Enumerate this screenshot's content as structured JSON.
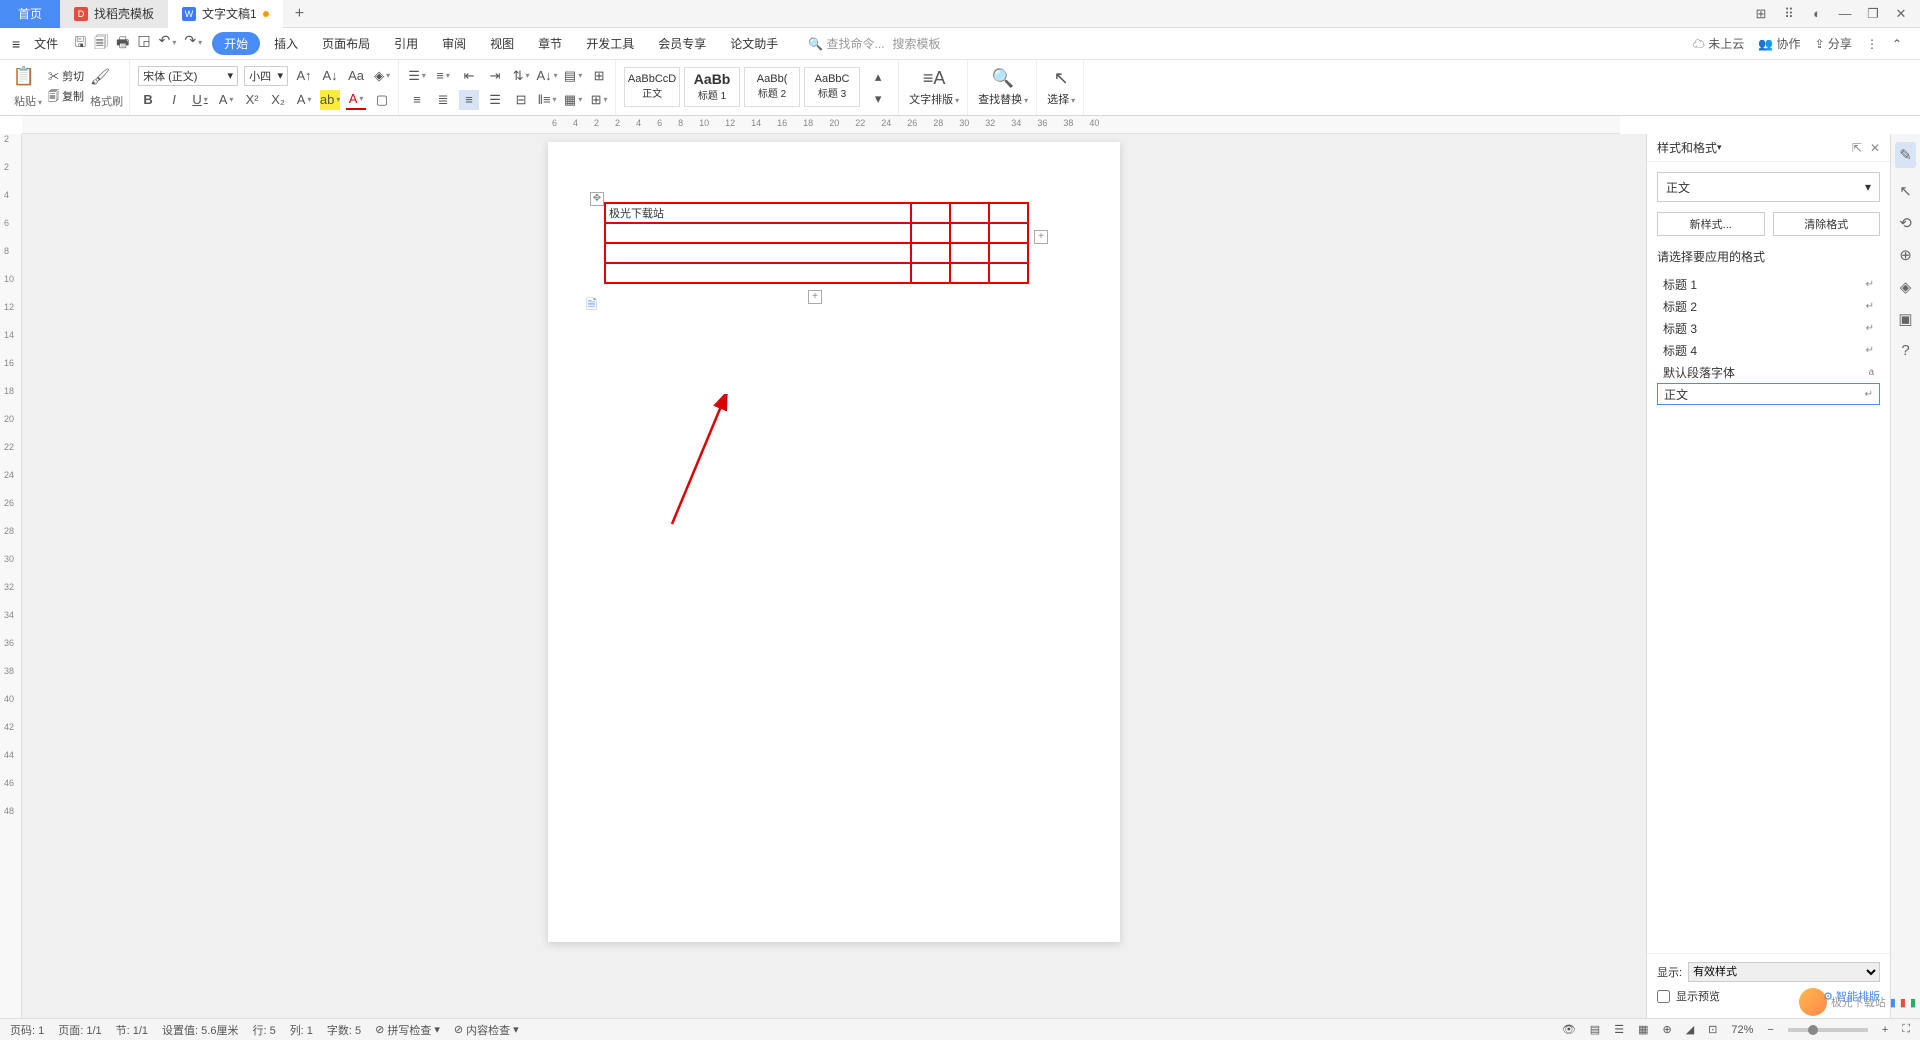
{
  "tabs": {
    "home": "首页",
    "template": "找稻壳模板",
    "doc": "文字文稿1"
  },
  "menu": {
    "file": "文件",
    "items": [
      "开始",
      "插入",
      "页面布局",
      "引用",
      "审阅",
      "视图",
      "章节",
      "开发工具",
      "会员专享",
      "论文助手"
    ],
    "search_cmd": "查找命令...",
    "search_tpl": "搜索模板"
  },
  "top_right": {
    "cloud": "未上云",
    "collab": "协作",
    "share": "分享"
  },
  "ribbon": {
    "paste": "粘贴",
    "cut": "剪切",
    "copy": "复制",
    "format_painter": "格式刷",
    "font_name": "宋体 (正文)",
    "font_size": "小四",
    "styles": [
      {
        "preview": "AaBbCcD",
        "label": "正文"
      },
      {
        "preview": "AaBb",
        "label": "标题 1"
      },
      {
        "preview": "AaBb(",
        "label": "标题 2"
      },
      {
        "preview": "AaBbC",
        "label": "标题 3"
      }
    ],
    "text_layout": "文字排版",
    "find_replace": "查找替换",
    "select": "选择"
  },
  "ruler_h": [
    "6",
    "4",
    "2",
    "2",
    "4",
    "6",
    "8",
    "10",
    "12",
    "14",
    "16",
    "18",
    "20",
    "22",
    "24",
    "26",
    "28",
    "30",
    "32",
    "34",
    "36",
    "38",
    "40"
  ],
  "ruler_v": [
    "2",
    "2",
    "4",
    "6",
    "8",
    "10",
    "12",
    "14",
    "16",
    "18",
    "20",
    "22",
    "24",
    "26",
    "28",
    "30",
    "32",
    "34",
    "36",
    "38",
    "40",
    "42",
    "44",
    "46",
    "48"
  ],
  "table_cell": "极光下载站",
  "panel": {
    "title": "样式和格式",
    "current_style": "正文",
    "new_style": "新样式...",
    "clear_format": "清除格式",
    "apply_label": "请选择要应用的格式",
    "list": [
      "标题 1",
      "标题 2",
      "标题 3",
      "标题 4",
      "默认段落字体",
      "正文"
    ],
    "display_label": "显示:",
    "display_value": "有效样式",
    "preview_check": "显示预览",
    "smart_layout": "智能排版"
  },
  "statusbar": {
    "page_no": "页码: 1",
    "page_of": "页面: 1/1",
    "section": "节: 1/1",
    "pos": "设置值: 5.6厘米",
    "row": "行: 5",
    "col": "列: 1",
    "words": "字数: 5",
    "spell": "拼写检查",
    "content": "内容检查",
    "zoom": "72%"
  },
  "watermark_text": "极光下载站"
}
